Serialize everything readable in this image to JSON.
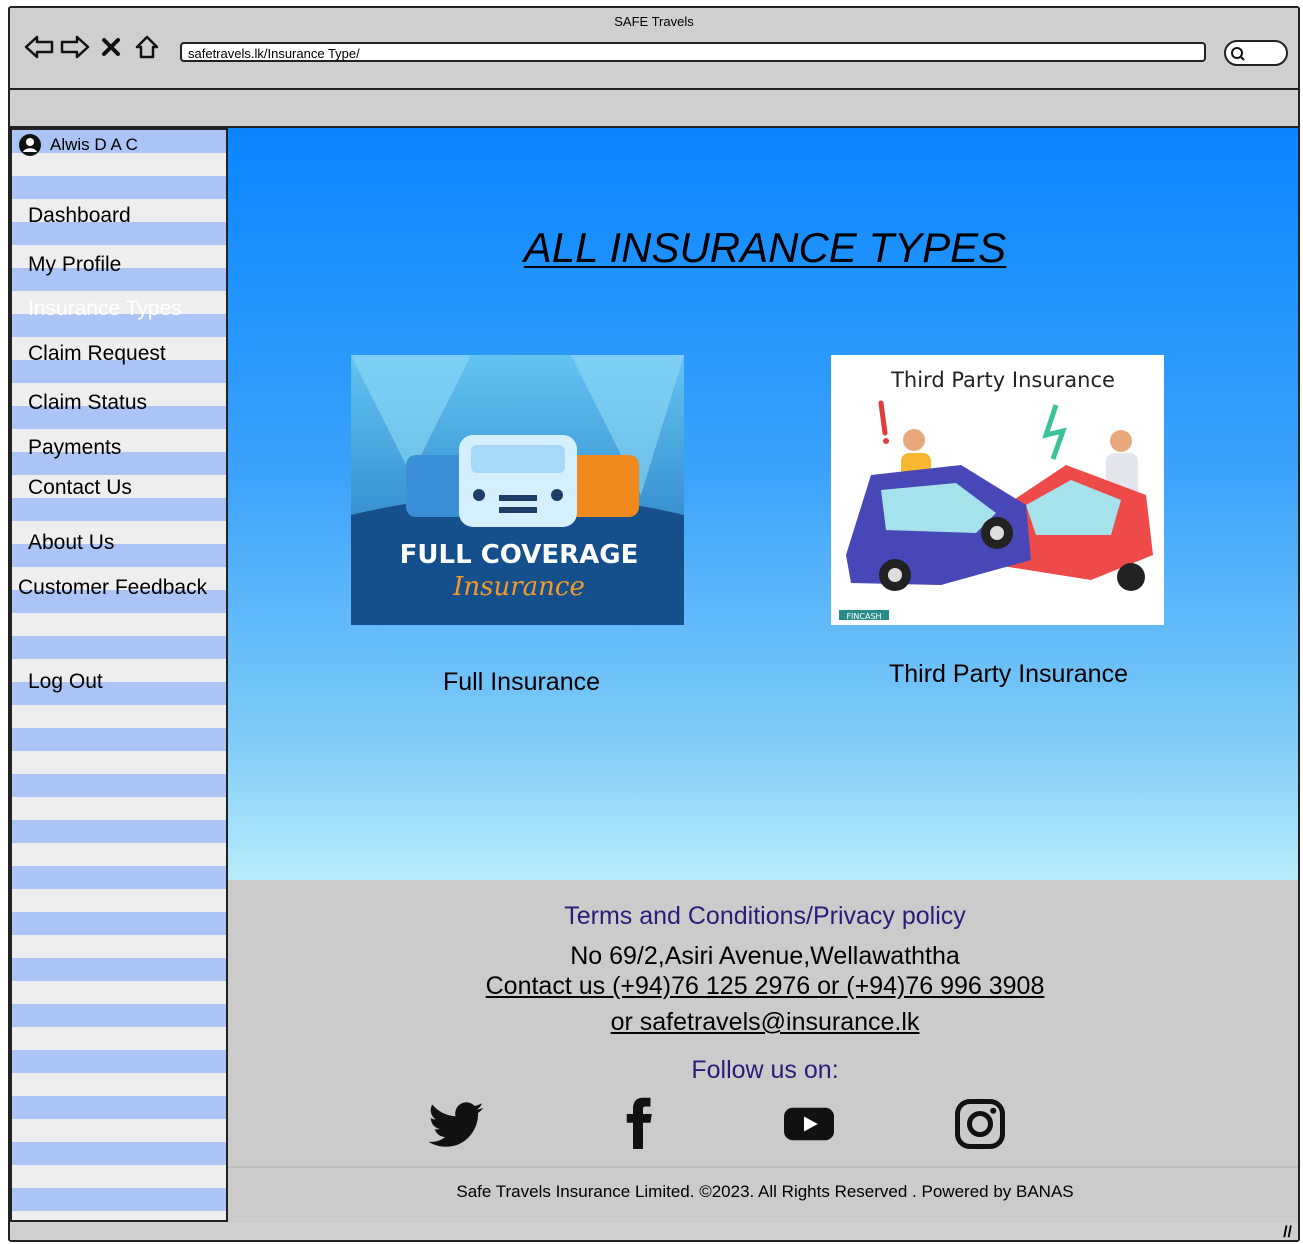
{
  "window": {
    "title": "SAFE Travels"
  },
  "browser": {
    "url": "safetravels.lk/Insurance Type/",
    "back_icon": "arrow-left-icon",
    "forward_icon": "arrow-right-icon",
    "stop_icon": "close-icon",
    "home_icon": "home-icon",
    "search_icon": "search-icon"
  },
  "sidebar": {
    "user_name": "Alwis D A C",
    "items": [
      {
        "label": "Dashboard"
      },
      {
        "label": "My Profile"
      },
      {
        "label": "Insurance Types",
        "active": true
      },
      {
        "label": "Claim Request"
      },
      {
        "label": "Claim Status"
      },
      {
        "label": "Payments"
      },
      {
        "label": "Contact Us"
      },
      {
        "label": "About Us"
      },
      {
        "label": "Customer Feedback"
      },
      {
        "label": "Log Out"
      }
    ]
  },
  "main": {
    "heading": "ALL INSURANCE TYPES",
    "cards": [
      {
        "label": "Full Insurance",
        "image_text_1": "FULL COVERAGE",
        "image_text_2": "Insurance"
      },
      {
        "label": "Third Party Insurance",
        "image_text_1": "Third Party Insurance",
        "image_text_2": "FINCASH"
      }
    ]
  },
  "footer": {
    "terms": "Terms and Conditions/Privacy policy",
    "address": "No 69/2,Asiri Avenue,Wellawaththa",
    "contact": "Contact us (+94)76 125 2976 or (+94)76 996 3908",
    "email": "or  safetravels@insurance.lk",
    "follow": "Follow us on:",
    "social": [
      "twitter-icon",
      "facebook-icon",
      "youtube-icon",
      "instagram-icon"
    ],
    "copyright": "Safe Travels Insurance Limited. ©2023. All Rights Reserved . Powered by BANAS"
  },
  "colors": {
    "sidebar_stripe": "#a9c4f5",
    "main_gradient_top": "#0a86ff",
    "main_gradient_bottom": "#b8ecfb",
    "footer_link": "#2e1a78",
    "active_nav": "#ffffff"
  }
}
